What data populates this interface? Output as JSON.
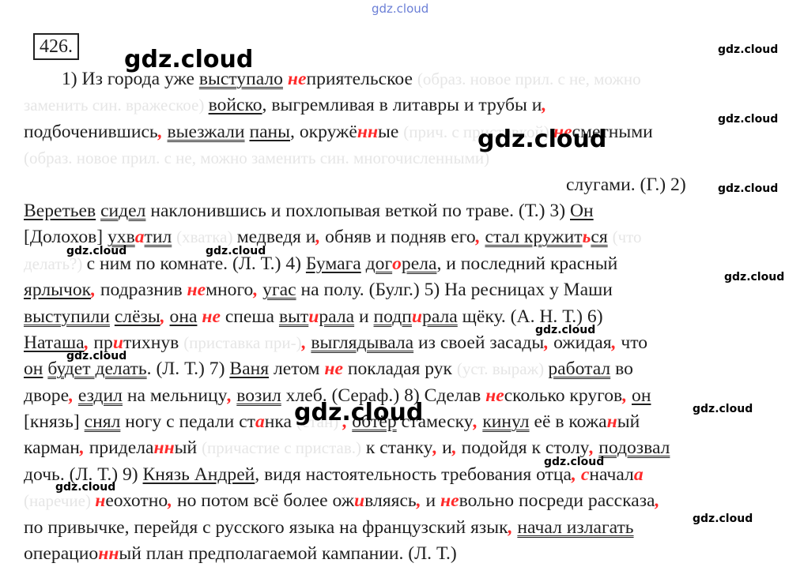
{
  "exercise_number": "426.",
  "watermark_text": "gdz.cloud",
  "lines": [
    [
      [
        "1) Из города уже ",
        ""
      ],
      [
        "выступало",
        "u2"
      ],
      [
        " ",
        ""
      ],
      [
        "не",
        "r"
      ],
      [
        "приятельское ",
        ""
      ],
      [
        "(образ. новое прил. с не, можно",
        "ghost"
      ]
    ],
    [
      [
        "заменить син. вражеское) ",
        "ghost"
      ],
      [
        "войско",
        "u1"
      ],
      [
        ", выгремливая в литавры и трубы и",
        ""
      ],
      [
        ",",
        "r"
      ]
    ],
    [
      [
        "подбоченившись",
        ""
      ],
      [
        ",",
        "r"
      ],
      [
        " ",
        ""
      ],
      [
        "выезжали",
        "u2"
      ],
      [
        " ",
        ""
      ],
      [
        "паны",
        "u1"
      ],
      [
        ", окружё",
        ""
      ],
      [
        "нн",
        "r"
      ],
      [
        "ые ",
        ""
      ],
      [
        "(прич. с приставкой) ",
        "ghost"
      ],
      [
        "не",
        "r"
      ],
      [
        "сметными",
        ""
      ]
    ],
    [
      [
        "(образ. новое прил. с не, можно заменить син. многочисленными)",
        "ghost"
      ]
    ],
    [
      [
        "слугами. (Г.) 2)",
        ""
      ]
    ],
    [
      [
        "Веретьев",
        "u1"
      ],
      [
        " ",
        ""
      ],
      [
        "сидел",
        "u2"
      ],
      [
        " наклонившись и похлопывая веткой по траве. (Т.) 3) ",
        ""
      ],
      [
        "Он",
        "u1"
      ]
    ],
    [
      [
        "[Долохов] ",
        ""
      ],
      [
        "ухв",
        "u2"
      ],
      [
        "а",
        "r"
      ],
      [
        "тил",
        "u2"
      ],
      [
        " ",
        ""
      ],
      [
        "(хватка) ",
        "ghost"
      ],
      [
        "медведя и",
        ""
      ],
      [
        ",",
        "r"
      ],
      [
        " обняв и подняв его",
        ""
      ],
      [
        ",",
        "r"
      ],
      [
        " ",
        ""
      ],
      [
        "стал кружит",
        "u2"
      ],
      [
        "ь",
        "r"
      ],
      [
        "ся",
        "u2"
      ],
      [
        " ",
        ""
      ],
      [
        "(что",
        "ghost"
      ]
    ],
    [
      [
        "делать?) ",
        "ghost"
      ],
      [
        "с ним по комнате. (Л. Т.) 4) ",
        ""
      ],
      [
        "Бумага",
        "u1"
      ],
      [
        " ",
        ""
      ],
      [
        "дог",
        "u2"
      ],
      [
        "о",
        "r"
      ],
      [
        "рела",
        "u2"
      ],
      [
        ", и последний красный",
        ""
      ]
    ],
    [
      [
        "ярлычок",
        "u1"
      ],
      [
        ",",
        "r"
      ],
      [
        " подразнив ",
        ""
      ],
      [
        "не",
        "r"
      ],
      [
        "много",
        ""
      ],
      [
        ",",
        "r"
      ],
      [
        " ",
        ""
      ],
      [
        "угас",
        "u2"
      ],
      [
        " на полу. (Булг.) 5) На ресницах у Маши",
        ""
      ]
    ],
    [
      [
        "выступили",
        "u2"
      ],
      [
        " ",
        ""
      ],
      [
        "слёзы",
        "u1"
      ],
      [
        ",",
        "r"
      ],
      [
        " ",
        ""
      ],
      [
        "она",
        "u1"
      ],
      [
        " ",
        ""
      ],
      [
        "не",
        "r"
      ],
      [
        " спеша ",
        ""
      ],
      [
        "выт",
        "u2"
      ],
      [
        "и",
        "r"
      ],
      [
        "рала",
        "u2"
      ],
      [
        " и ",
        ""
      ],
      [
        "подп",
        "u2"
      ],
      [
        "и",
        "r"
      ],
      [
        "рала",
        "u2"
      ],
      [
        " щёку. (А. Н. Т.) 6)",
        ""
      ]
    ],
    [
      [
        "Наташа",
        "u1"
      ],
      [
        ",",
        "r"
      ],
      [
        " пр",
        ""
      ],
      [
        "и",
        "r"
      ],
      [
        "тихнув ",
        ""
      ],
      [
        "(приставка при-)",
        "ghost"
      ],
      [
        ",",
        "r"
      ],
      [
        " ",
        ""
      ],
      [
        "выглядывала",
        "u2"
      ],
      [
        " из своей засады",
        ""
      ],
      [
        ",",
        "r"
      ],
      [
        " ожидая",
        ""
      ],
      [
        ",",
        "r"
      ],
      [
        " что",
        ""
      ]
    ],
    [
      [
        "он",
        "u1"
      ],
      [
        " ",
        ""
      ],
      [
        "будет делать",
        "u2"
      ],
      [
        ". (Л. Т.) 7) ",
        ""
      ],
      [
        "Ваня",
        "u1"
      ],
      [
        " летом ",
        ""
      ],
      [
        "не",
        "r"
      ],
      [
        " покладая рук ",
        ""
      ],
      [
        "(уст. выраж) ",
        "ghost"
      ],
      [
        "работал",
        "u2"
      ],
      [
        " во",
        ""
      ]
    ],
    [
      [
        "дворе",
        ""
      ],
      [
        ",",
        "r"
      ],
      [
        " ",
        ""
      ],
      [
        "ездил",
        "u2"
      ],
      [
        " на мельницу",
        ""
      ],
      [
        ",",
        "r"
      ],
      [
        " ",
        ""
      ],
      [
        "возил",
        "u2"
      ],
      [
        " хлеб. (Сераф.) 8) Сделав ",
        ""
      ],
      [
        "не",
        "r"
      ],
      [
        "сколько кругов",
        ""
      ],
      [
        ",",
        "r"
      ],
      [
        " ",
        ""
      ],
      [
        "он",
        "u1"
      ]
    ],
    [
      [
        "[князь] ",
        ""
      ],
      [
        "снял",
        "u2"
      ],
      [
        " ногу с педали ст",
        ""
      ],
      [
        "а",
        "r"
      ],
      [
        "нка ",
        ""
      ],
      [
        "(стан) ",
        "ghost"
      ],
      [
        ",",
        "r"
      ],
      [
        " ",
        ""
      ],
      [
        "обтёр",
        "u2"
      ],
      [
        " стамеску",
        ""
      ],
      [
        ",",
        "r"
      ],
      [
        " ",
        ""
      ],
      [
        "кинул",
        "u2"
      ],
      [
        " её в кожа",
        ""
      ],
      [
        "н",
        "r"
      ],
      [
        "ый",
        ""
      ]
    ],
    [
      [
        "карман",
        ""
      ],
      [
        ",",
        "r"
      ],
      [
        " придела",
        ""
      ],
      [
        "нн",
        "r"
      ],
      [
        "ый ",
        ""
      ],
      [
        "(причастие с пристав.)",
        "ghost"
      ],
      [
        " к станку",
        ""
      ],
      [
        ",",
        "r"
      ],
      [
        " и",
        ""
      ],
      [
        ",",
        "r"
      ],
      [
        " подойдя к столу",
        ""
      ],
      [
        ",",
        "r"
      ],
      [
        " ",
        ""
      ],
      [
        "подозвал",
        "u2"
      ]
    ],
    [
      [
        "дочь. (Л. Т.) 9) ",
        ""
      ],
      [
        "Князь Андрей",
        "u1"
      ],
      [
        ", видя настоятельность требования отца",
        ""
      ],
      [
        ",",
        "r"
      ],
      [
        " ",
        ""
      ],
      [
        "с",
        "r"
      ],
      [
        "начал",
        ""
      ],
      [
        "а",
        "r"
      ]
    ],
    [
      [
        "(наречие) ",
        "ghost"
      ],
      [
        "н",
        "r"
      ],
      [
        "еохотно",
        ""
      ],
      [
        ",",
        "r"
      ],
      [
        " но потом всё более ож",
        ""
      ],
      [
        "и",
        "r"
      ],
      [
        "вляясь",
        ""
      ],
      [
        ",",
        "r"
      ],
      [
        " и ",
        ""
      ],
      [
        "не",
        "r"
      ],
      [
        "вольно посреди рассказа",
        ""
      ],
      [
        ",",
        "r"
      ]
    ],
    [
      [
        "по привычке, перейдя с русского языка на французский язык",
        ""
      ],
      [
        ",",
        "r"
      ],
      [
        " ",
        ""
      ],
      [
        "начал излагать",
        "u2"
      ]
    ],
    [
      [
        "операцио",
        ""
      ],
      [
        "нн",
        "r"
      ],
      [
        "ый план предполагаемой кампании. (Л. Т.)",
        ""
      ]
    ]
  ]
}
